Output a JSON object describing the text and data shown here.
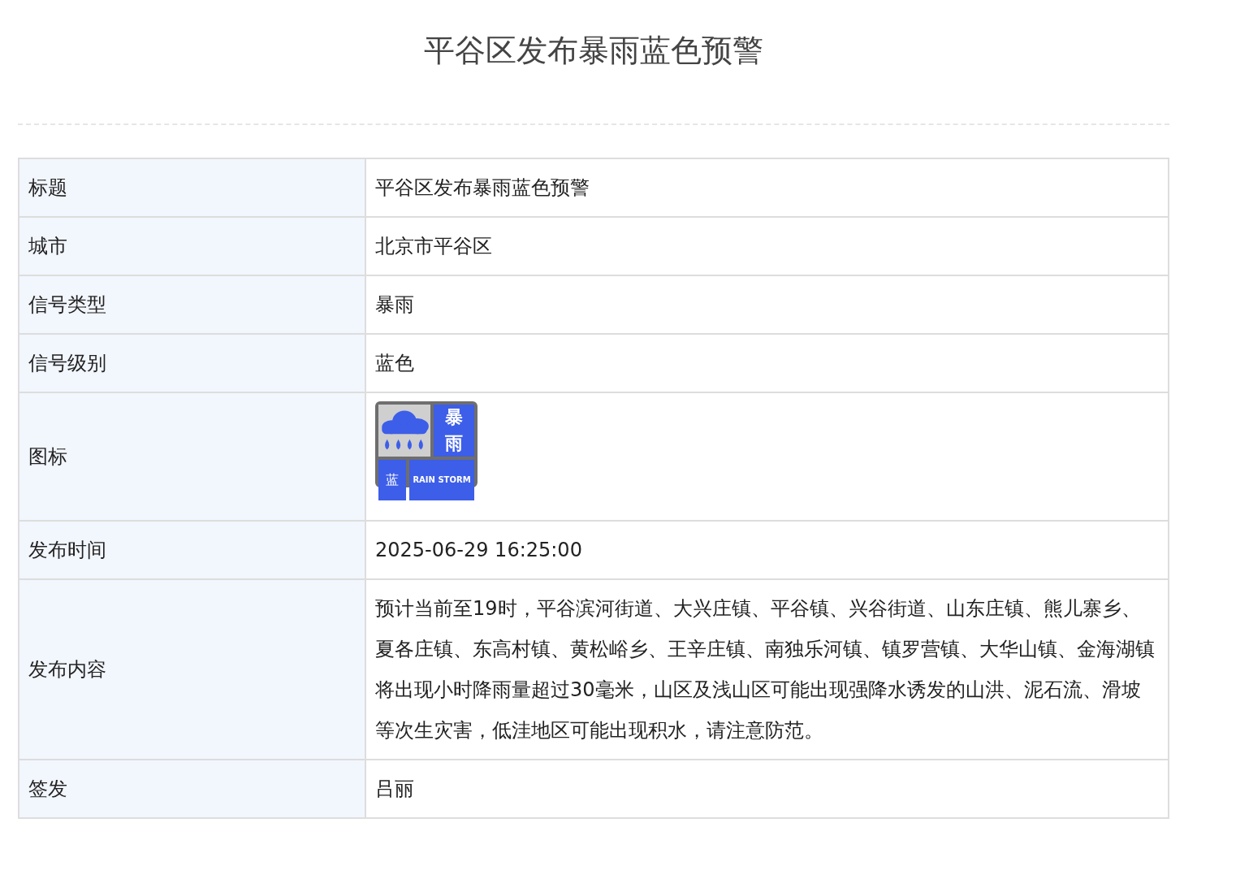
{
  "title": "平谷区发布暴雨蓝色预警",
  "rows": [
    {
      "kind": "text",
      "label": "标题",
      "value": "平谷区发布暴雨蓝色预警"
    },
    {
      "kind": "text",
      "label": "城市",
      "value": "北京市平谷区"
    },
    {
      "kind": "text",
      "label": "信号类型",
      "value": "暴雨"
    },
    {
      "kind": "text",
      "label": "信号级别",
      "value": "蓝色"
    },
    {
      "kind": "icon",
      "label": "图标",
      "sign": {
        "top": "暴",
        "bottom": "雨",
        "level": "蓝",
        "caption": "RAIN STORM",
        "color": "#3d5ee8"
      }
    },
    {
      "kind": "text",
      "label": "发布时间",
      "value": "2025-06-29 16:25:00"
    },
    {
      "kind": "text",
      "label": "发布内容",
      "value": "预计当前至19时，平谷滨河街道、大兴庄镇、平谷镇、兴谷街道、山东庄镇、熊儿寨乡、夏各庄镇、东高村镇、黄松峪乡、王辛庄镇、南独乐河镇、镇罗营镇、大华山镇、金海湖镇将出现小时降雨量超过30毫米，山区及浅山区可能出现强降水诱发的山洪、泥石流、滑坡等次生灾害，低洼地区可能出现积水，请注意防范。"
    },
    {
      "kind": "text",
      "label": "签发",
      "value": "吕丽"
    }
  ]
}
